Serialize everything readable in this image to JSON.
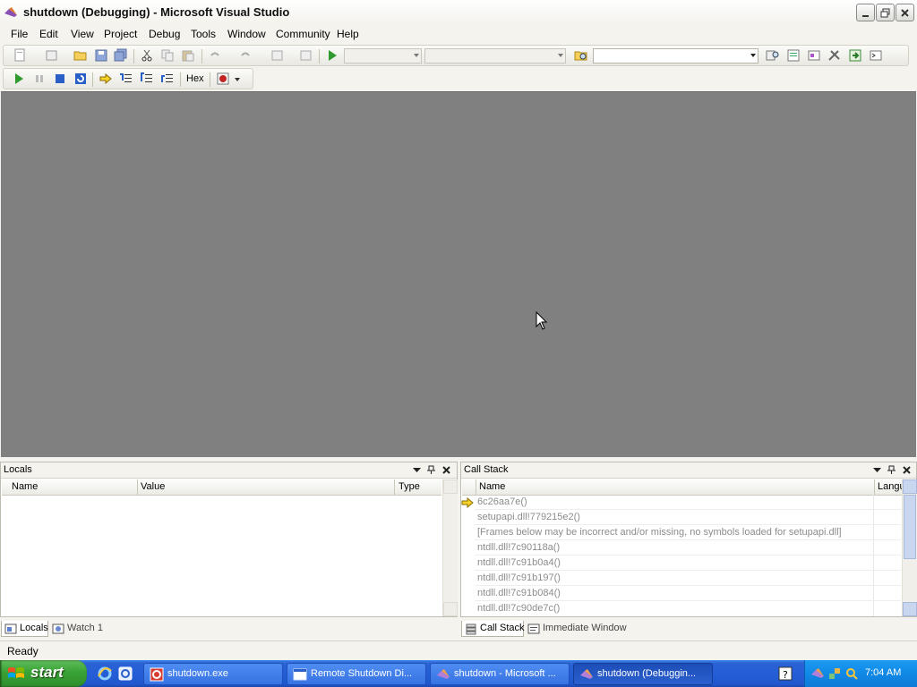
{
  "window": {
    "title": "shutdown (Debugging) - Microsoft Visual Studio",
    "icon": "visual-studio-icon"
  },
  "menu": [
    "File",
    "Edit",
    "View",
    "Project",
    "Debug",
    "Tools",
    "Window",
    "Community",
    "Help"
  ],
  "debug_toolbar": {
    "hex_label": "Hex"
  },
  "locals": {
    "title": "Locals",
    "columns": [
      "Name",
      "Value",
      "Type"
    ]
  },
  "callstack": {
    "title": "Call Stack",
    "columns": [
      "Name",
      "Langu"
    ],
    "rows": [
      "6c26aa7e()",
      "setupapi.dll!779215e2()",
      "[Frames below may be incorrect and/or missing, no symbols loaded for setupapi.dll]",
      "ntdll.dll!7c90118a()",
      "ntdll.dll!7c91b0a4()",
      "ntdll.dll!7c91b197()",
      "ntdll.dll!7c91b084()",
      "ntdll.dll!7c90de7c()"
    ]
  },
  "bottom_tabs_left": [
    "Locals",
    "Watch 1"
  ],
  "bottom_tabs_right": [
    "Call Stack",
    "Immediate Window"
  ],
  "status": "Ready",
  "taskbar": {
    "start": "start",
    "tasks": [
      {
        "label": "shutdown.exe",
        "icon": "app-icon"
      },
      {
        "label": "Remote Shutdown Di...",
        "icon": "window-icon"
      },
      {
        "label": "shutdown - Microsoft ...",
        "icon": "visual-studio-icon"
      },
      {
        "label": "shutdown (Debuggin...",
        "icon": "visual-studio-icon"
      }
    ],
    "clock": "7:04 AM"
  },
  "colors": {
    "editor_bg": "#808080",
    "taskbar_blue": "#245ed6",
    "start_green": "#39a236"
  }
}
